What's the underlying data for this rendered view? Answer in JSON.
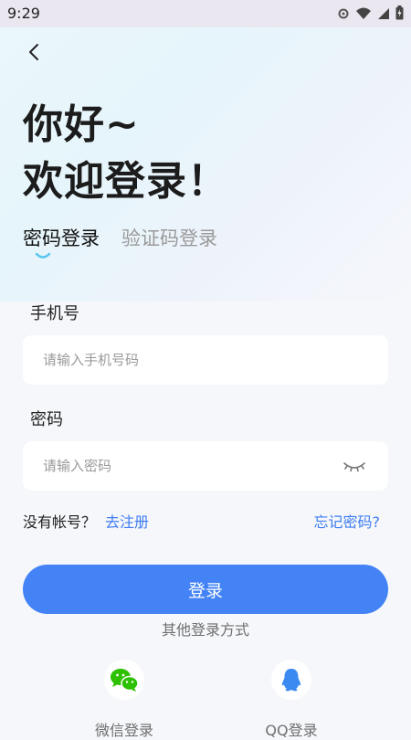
{
  "status_bar": {
    "time": "9:29",
    "icons": [
      "gear-icon",
      "wifi-icon",
      "signal-icon",
      "battery-icon"
    ]
  },
  "header": {
    "back_icon": "back-arrow-icon",
    "greeting_line1": "你好~",
    "greeting_line2": "欢迎登录！"
  },
  "tabs": [
    {
      "label": "密码登录",
      "active": true
    },
    {
      "label": "验证码登录",
      "active": false
    }
  ],
  "form": {
    "phone_label": "手机号",
    "phone_placeholder": "请输入手机号码",
    "password_label": "密码",
    "password_placeholder": "请输入密码",
    "password_toggle_icon": "eye-closed-icon"
  },
  "links": {
    "no_account": "没有帐号？",
    "register": "去注册",
    "forgot": "忘记密码?"
  },
  "login_button": {
    "label": "登录"
  },
  "other_login": {
    "title": "其他登录方式",
    "options": [
      {
        "label": "微信登录",
        "icon": "wechat-icon",
        "color": "#2dc100"
      },
      {
        "label": "QQ登录",
        "icon": "qq-icon",
        "color": "#3a8af2"
      }
    ]
  },
  "colors": {
    "accent": "#4383f5",
    "link": "#3d7cf0",
    "tab_indicator": "#5ec7ef"
  }
}
